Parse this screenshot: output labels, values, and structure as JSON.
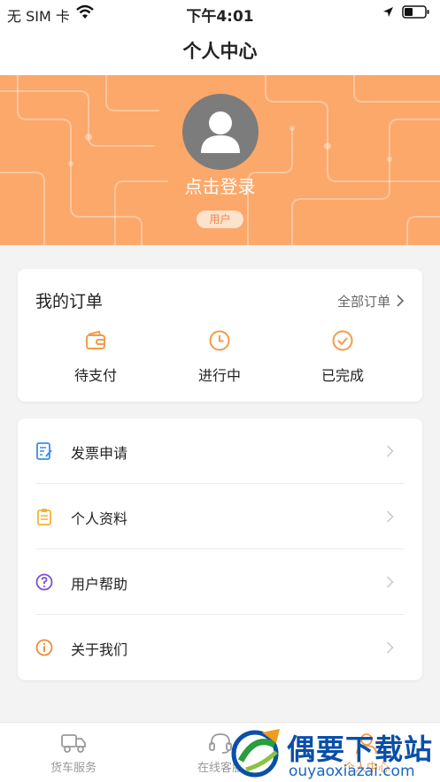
{
  "status_bar": {
    "carrier": "无 SIM 卡",
    "time": "下午4:01"
  },
  "header": {
    "title": "个人中心"
  },
  "profile": {
    "login_text": "点击登录",
    "role_badge": "用户",
    "banner_color": "#fba86a"
  },
  "orders": {
    "title": "我的订单",
    "all_orders": "全部订单",
    "statuses": [
      {
        "label": "待支付",
        "icon": "wallet-icon"
      },
      {
        "label": "进行中",
        "icon": "clock-icon"
      },
      {
        "label": "已完成",
        "icon": "check-circle-icon"
      }
    ]
  },
  "menu": {
    "items": [
      {
        "label": "发票申请",
        "icon": "invoice-icon",
        "color": "#3a8ee6"
      },
      {
        "label": "个人资料",
        "icon": "clipboard-icon",
        "color": "#f2b233"
      },
      {
        "label": "用户帮助",
        "icon": "help-icon",
        "color": "#7b4fd0"
      },
      {
        "label": "关于我们",
        "icon": "info-icon",
        "color": "#ef8a35"
      }
    ]
  },
  "tab_bar": {
    "tabs": [
      {
        "label": "货车服务",
        "icon": "truck-icon",
        "active": false
      },
      {
        "label": "在线客服",
        "icon": "headset-icon",
        "active": false
      },
      {
        "label": "个人中心",
        "icon": "person-icon",
        "active": true
      }
    ]
  },
  "watermark": {
    "brand": "偶要下载站",
    "url": "ouyaoxiazai.com"
  },
  "colors": {
    "accent": "#f39b4a",
    "background": "#f3f3f3"
  }
}
